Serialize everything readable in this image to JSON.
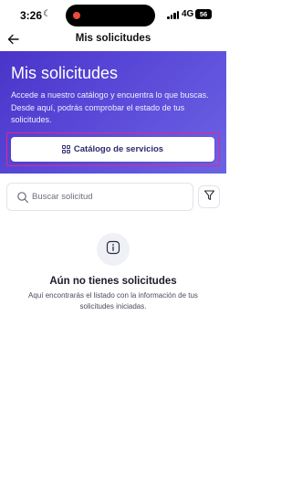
{
  "status_bar": {
    "time": "3:26",
    "moon_icon": "moon-icon",
    "network": "4G",
    "battery": "56",
    "recording_color": "#e74c3c"
  },
  "nav": {
    "back_icon": "arrow-left-icon",
    "title": "Mis solicitudes"
  },
  "hero": {
    "title": "Mis solicitudes",
    "description": "Accede a nuestro catálogo y encuentra lo que buscas. Desde aquí, podrás comprobar el estado de tus solicitudes.",
    "catalog_button": {
      "icon": "grid-icon",
      "label": "Catálogo de servicios"
    },
    "gradient_start": "#4a34c9",
    "gradient_end": "#6b63e4"
  },
  "search": {
    "icon": "search-icon",
    "placeholder": "Buscar solicitud",
    "value": ""
  },
  "filter": {
    "icon": "filter-icon"
  },
  "empty_state": {
    "icon": "info-icon",
    "title": "Aún no tienes solicitudes",
    "description": "Aquí encontrarás el listado con la información de tus solicitudes iniciadas."
  }
}
